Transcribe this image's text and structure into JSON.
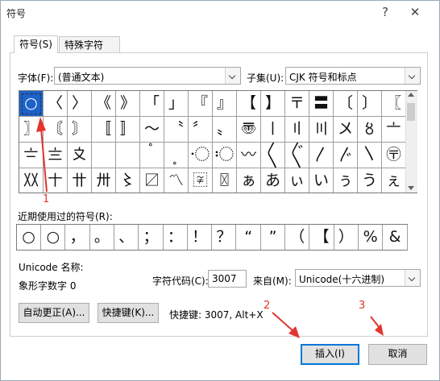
{
  "window": {
    "title": "符号",
    "help_glyph": "?",
    "close_glyph": "✕"
  },
  "tabs": [
    {
      "label": "符号(S)"
    },
    {
      "label": "特殊字符(P)"
    }
  ],
  "font": {
    "label": "字体(F):",
    "value": "(普通文本)"
  },
  "subset": {
    "label": "子集(U):",
    "value": "CJK 符号和标点"
  },
  "symbol_rows": [
    [
      "○",
      "〈",
      "〉",
      "《",
      "》",
      "「",
      "」",
      "『",
      "』",
      "【",
      "】",
      "〒",
      "〓",
      "〔",
      "〕",
      "〖"
    ],
    [
      "〗",
      "〘",
      "〙",
      "〚",
      "〛",
      "〜",
      "〝",
      "〞",
      "〟",
      "〠",
      "〡",
      "〢",
      "〣",
      "〤",
      "〥",
      "〦"
    ],
    [
      "〧",
      "〨",
      "〩",
      "〪",
      "〫",
      "〬",
      "〭",
      "〮",
      "〯",
      "〰",
      "〱",
      "〲",
      "〳",
      "〴",
      "〵",
      "〶"
    ],
    [
      "〷",
      "〸",
      "〹",
      "〺",
      "〻",
      "〼",
      "〽",
      "〾",
      "〿",
      "ぁ",
      "あ",
      "ぃ",
      "い",
      "ぅ",
      "う",
      "ぇ"
    ]
  ],
  "recent": {
    "label": "近期使用过的符号(R):",
    "symbols": [
      "○",
      "○",
      "，",
      "。",
      "、",
      "；",
      "：",
      "！",
      "？",
      "“",
      "”",
      "（",
      "【",
      "）",
      "%",
      "&"
    ]
  },
  "unicode_name_label": "Unicode 名称:",
  "unicode_name_value": "象形字数字 0",
  "char_code": {
    "label": "字符代码(C):",
    "value": "3007"
  },
  "from": {
    "label": "来自(M):",
    "value": "Unicode(十六进制)"
  },
  "buttons": {
    "autocorrect": "自动更正(A)...",
    "shortcut_key": "快捷键(K)...",
    "insert": "插入(I)",
    "cancel": "取消"
  },
  "shortcut_text": "快捷键: 3007, Alt+X",
  "annotations": {
    "one": "1",
    "two": "2",
    "three": "3"
  },
  "colors": {
    "annotation": "#e3342f",
    "selection": "#1c62c9",
    "primary_border": "#0078d7"
  }
}
